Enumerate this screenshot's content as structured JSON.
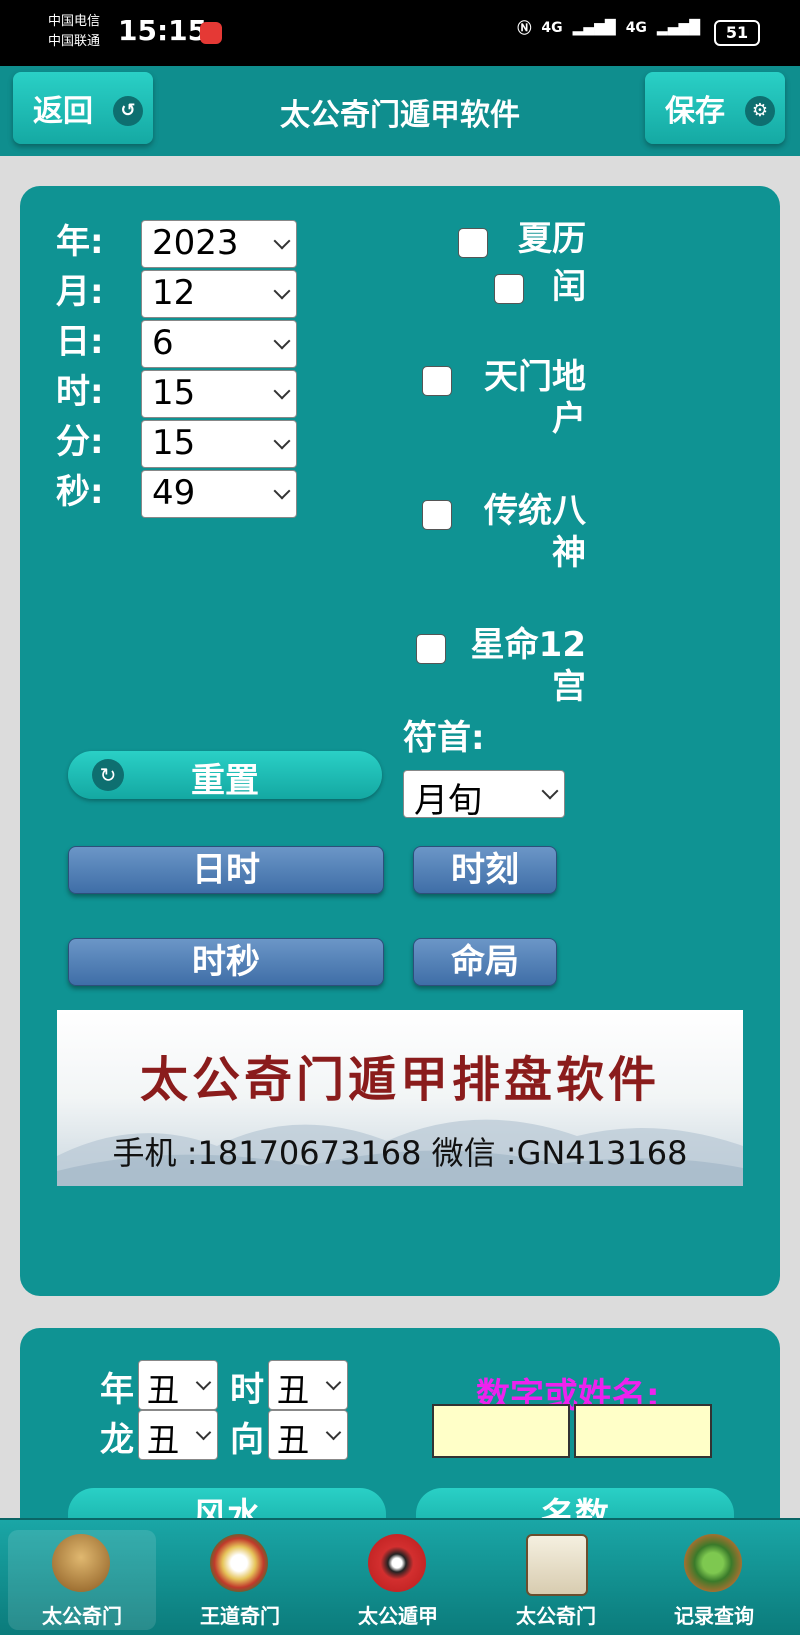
{
  "status": {
    "carrier1": "中国电信",
    "carrier2": "中国联通",
    "time": "15:15",
    "net1": "4G",
    "net2": "4G",
    "battery": "51"
  },
  "header": {
    "back_label": "返回",
    "title": "太公奇门遁甲软件",
    "save_label": "保存"
  },
  "date": {
    "year_label": "年:",
    "year": "2023",
    "month_label": "月:",
    "month": "12",
    "day_label": "日:",
    "day": "6",
    "hour_label": "时:",
    "hour": "15",
    "minute_label": "分:",
    "minute": "15",
    "second_label": "秒:",
    "second": "49"
  },
  "options": {
    "lunar_label": "夏历",
    "leap_label": "闰",
    "tianmen_l1": "天门地",
    "tianmen_l2": "户",
    "bashen_l1": "传统八",
    "bashen_l2": "神",
    "xingming_l1": "星命12",
    "xingming_l2": "宫"
  },
  "fushou": {
    "label": "符首:",
    "value": "月旬"
  },
  "buttons": {
    "reset": "重置",
    "rishi": "日时",
    "shike": "时刻",
    "shimiao": "时秒",
    "mingju": "命局"
  },
  "banner": {
    "title": "太公奇门遁甲排盘软件",
    "contact": "手机 :18170673168  微信 :GN413168"
  },
  "fengshui": {
    "year_label": "年",
    "year_value": "丑",
    "hour_label": "时",
    "hour_value": "丑",
    "dragon_label": "龙",
    "dragon_value": "丑",
    "direction_label": "向",
    "direction_value": "丑",
    "prompt": "数字或姓名:",
    "fengshui_btn": "风水",
    "mingshu_btn": "名数"
  },
  "nav": {
    "items": [
      {
        "label": "太公奇门"
      },
      {
        "label": "王道奇门"
      },
      {
        "label": "太公遁甲"
      },
      {
        "label": "太公奇门"
      },
      {
        "label": "记录查询"
      }
    ]
  }
}
